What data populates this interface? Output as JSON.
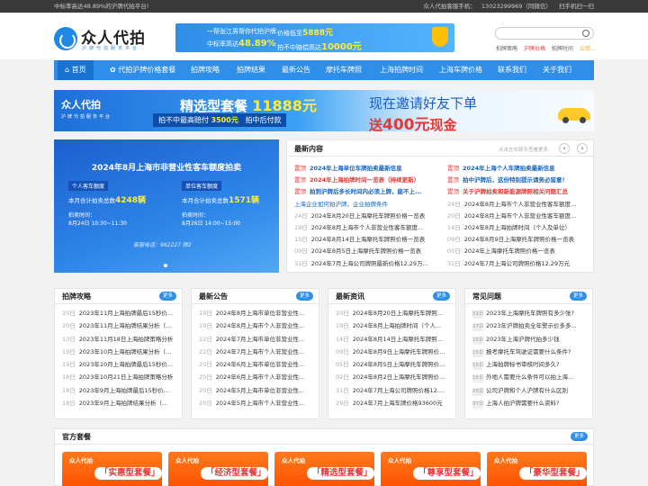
{
  "topbar": {
    "left": "中标率高达48.89%的沪牌代拍平台!",
    "phone_label": "众人代拍客服手机：",
    "phone": "13023299969（同微信）",
    "scan": "扫手机扫一扫"
  },
  "logo": {
    "name": "众人代拍",
    "sub": "沪牌代拍服务平台"
  },
  "header_banner": {
    "line1": "一帮张江男帮你代拍沪牌",
    "price_label": "价格低至",
    "price": "5888元",
    "rate_label": "中标率高达",
    "rate": "48.89%",
    "comp_label": "拍不中赔偿高达",
    "comp": "10000元"
  },
  "search": {
    "placeholder": ""
  },
  "header_links": [
    "拍牌策略",
    "沪牌价格",
    "拍牌时间",
    "公司..."
  ],
  "nav": [
    "首页",
    "代拍沪牌价格套餐",
    "拍牌攻略",
    "拍牌结果",
    "最新公告",
    "摩托车牌照",
    "上海拍牌时间",
    "上海车牌价格",
    "联系我们",
    "关于我们"
  ],
  "wide_banner": {
    "logo": "众人代拍",
    "logo_sub": "沪牌代拍服务平台",
    "title": "精选型套餐",
    "price": "11888元",
    "sub_a": "拍不中最高赔付",
    "sub_b": "3500元",
    "sub_c": "拍中后付款",
    "invite": "现在邀请好友下单",
    "cash_a": "送",
    "cash_b": "400元",
    "cash_c": "现金"
  },
  "slide": {
    "title": "2024年8月上海市非营业性客车额度拍卖",
    "left_tag": "个人客车额度",
    "left_text": "本月合计拍卖总数",
    "left_num": "4248辆",
    "right_tag": "单位客车额度",
    "right_text": "本月合计拍卖总数",
    "right_num": "1571辆",
    "left_time_label": "拍卖时间：",
    "left_time": "8月24日 10:30~11:30",
    "right_time_label": "拍卖时间：",
    "right_time": "8月26日 14:00~15:00",
    "hotline": "客服电话：962227 转2"
  },
  "news": {
    "title": "最新内容",
    "hint": "点击左右箭头查看更多",
    "prev": "‹",
    "next": "›",
    "left": [
      {
        "mark": "置顶",
        "text": "2024年上海单位车牌拍卖最新信息",
        "style": "blue-bold"
      },
      {
        "mark": "置顶",
        "text": "2024年上海拍牌时间一览表（持续更新）",
        "style": "red-bold"
      },
      {
        "mark": "置顶",
        "text": "拍到沪牌后多长时间内必须上牌，能不上...",
        "style": "blue-bold"
      },
      {
        "mark": "",
        "text": "上海企业如何拍沪牌，企业拍牌条件",
        "style": "blue"
      },
      {
        "mark": "24日",
        "text": "2024年8月20日上海摩托车牌照价格一览表",
        "style": ""
      },
      {
        "mark": "19日",
        "text": "2024年8月上海市个人非营业性客车额度...",
        "style": ""
      },
      {
        "mark": "15日",
        "text": "2024年8月14日上海摩托车牌照价格一览表",
        "style": ""
      },
      {
        "mark": "09日",
        "text": "2024年8月5日上海摩托车牌照价格一览表",
        "style": ""
      },
      {
        "mark": "31日",
        "text": "2024年7月上海公司牌照最新价格12.29万...",
        "style": ""
      }
    ],
    "right": [
      {
        "mark": "置顶",
        "text": "2024年上海个人车牌拍卖最新信息",
        "style": "blue-bold"
      },
      {
        "mark": "置顶",
        "text": "拍中沪牌后，这份特别提示请务必留意！",
        "style": "blue-bold"
      },
      {
        "mark": "置顶",
        "text": "关于沪牌拍卖和新能源牌照相关问题汇总",
        "style": "red-bold"
      },
      {
        "mark": "24日",
        "text": "2024年8月上海市个人非营业性客车额度...",
        "style": ""
      },
      {
        "mark": "20日",
        "text": "2024年8月上海市个人非营业性客车额度...",
        "style": ""
      },
      {
        "mark": "14日",
        "text": "2024年8月上海拍牌时间（个人及单位）",
        "style": ""
      },
      {
        "mark": "09日",
        "text": "2024年8月9日上海摩托车牌照价格一览表",
        "style": ""
      },
      {
        "mark": "05日",
        "text": "2024年上海摩托车牌照价格一览表",
        "style": ""
      },
      {
        "mark": "31日",
        "text": "2024年7月上海公司牌照价格12.29万元",
        "style": ""
      }
    ]
  },
  "boxes": [
    {
      "title": "拍牌攻略",
      "more": "更多",
      "items": [
        {
          "d": "20日",
          "t": "2023年11月上海拍牌最后15秒价..."
        },
        {
          "d": "20日",
          "t": "2023年11月上海拍牌结果分析（..."
        },
        {
          "d": "13日",
          "t": "2023年11月18日上海拍牌策略分析"
        },
        {
          "d": "19日",
          "t": "2023年10月上海拍牌结果分析（..."
        },
        {
          "d": "19日",
          "t": "2023年10月上海拍牌最后15秒价..."
        },
        {
          "d": "18日",
          "t": "2023年10月21日上海拍牌策略分析"
        },
        {
          "d": "18日",
          "t": "2023年9月上海拍牌最后15秒价..."
        },
        {
          "d": "18日",
          "t": "2023年9月上海拍牌结果分析（..."
        }
      ]
    },
    {
      "title": "最新公告",
      "more": "更多",
      "items": [
        {
          "d": "19日",
          "t": "2024年8月上海市单位非营业性..."
        },
        {
          "d": "19日",
          "t": "2024年8月上海市个人非营业性..."
        },
        {
          "d": "22日",
          "t": "2024年7月上海市单位非营业性..."
        },
        {
          "d": "22日",
          "t": "2024年7月上海市个人非营业性..."
        },
        {
          "d": "20日",
          "t": "2024年6月上海市单位非营业性..."
        },
        {
          "d": "20日",
          "t": "2024年6月上海市个人非营业性..."
        },
        {
          "d": "20日",
          "t": "2024年5月上海市单位非营业性..."
        },
        {
          "d": "20日",
          "t": "2024年5月上海市个人非营业性..."
        }
      ]
    },
    {
      "title": "最新资讯",
      "more": "更多",
      "items": [
        {
          "d": "20日",
          "t": "2024年8月20日上海摩托车牌照..."
        },
        {
          "d": "19日",
          "t": "2024年8月上海拍牌时间（个人..."
        },
        {
          "d": "14日",
          "t": "2024年8月14日上海摩托车牌照..."
        },
        {
          "d": "09日",
          "t": "2024年8月9日上海摩托车牌照价..."
        },
        {
          "d": "05日",
          "t": "2024年8月5日上海摩托车牌照价..."
        },
        {
          "d": "02日",
          "t": "2024年8月2日上海摩托车牌照价..."
        },
        {
          "d": "31日",
          "t": "2024年7月上海公司牌照价格12...."
        },
        {
          "d": "29日",
          "t": "2024年7月上海车牌价格93600元"
        }
      ]
    },
    {
      "title": "常见问题",
      "more": "更多",
      "items": [
        {
          "d": "01日",
          "t": "2023年上海摩托车牌照有多少张?"
        },
        {
          "d": "27日",
          "t": "2023年沪牌拍卖全年警示价多多..."
        },
        {
          "d": "15日",
          "t": "2023年上海沪牌代拍多少钱"
        },
        {
          "d": "15日",
          "t": "报考摩托车驾驶证需要什么条件?"
        },
        {
          "d": "15日",
          "t": "上海拍牌标书审核时间多久?"
        },
        {
          "d": "15日",
          "t": "外地人需要什么条件可以拍上海..."
        },
        {
          "d": "05日",
          "t": "公司沪牌和个人沪牌有什么区别"
        },
        {
          "d": "07日",
          "t": "上海人拍沪牌需要什么资料?"
        }
      ]
    }
  ],
  "packages": {
    "title": "官方套餐",
    "more": "更多",
    "items": [
      {
        "logo": "众人代拍",
        "name": "「实惠型套餐」"
      },
      {
        "logo": "众人代拍",
        "name": "「经济型套餐」"
      },
      {
        "logo": "众人代拍",
        "name": "「精选型套餐」"
      },
      {
        "logo": "众人代拍",
        "name": "「尊享型套餐」"
      },
      {
        "logo": "众人代拍",
        "name": "「豪华型套餐」"
      }
    ]
  }
}
